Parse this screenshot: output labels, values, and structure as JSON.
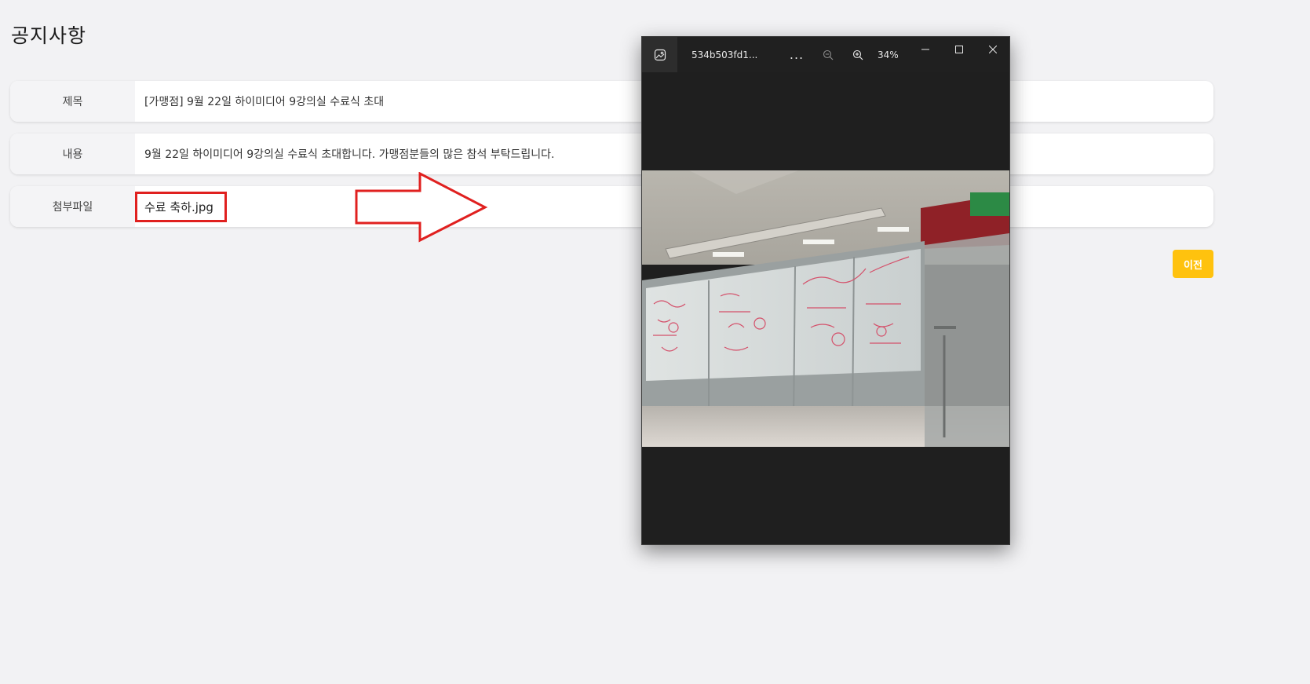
{
  "page": {
    "title": "공지사항"
  },
  "notice": {
    "rows": [
      {
        "label": "제목",
        "value": "[가맹점] 9월 22일 하이미디어 9강의실 수료식 초대"
      },
      {
        "label": "내용",
        "value": "9월 22일 하이미디어 9강의실 수료식 초대합니다. 가맹점분들의 많은 참석 부탁드립니다."
      },
      {
        "label": "첨부파일",
        "value": "수료 축하.jpg"
      }
    ]
  },
  "actions": {
    "prev_label": "이전",
    "prev_color": "#ffc20e"
  },
  "annotation": {
    "highlight_color": "#e0201f"
  },
  "viewer": {
    "filename": "534b503fd1...",
    "more_label": "...",
    "zoom_level": "34%",
    "icons": {
      "app": "image-icon",
      "zoom_out": "zoom-out-icon",
      "zoom_in": "zoom-in-icon",
      "minimize": "minimize-icon",
      "maximize": "maximize-icon",
      "close": "close-icon"
    }
  }
}
